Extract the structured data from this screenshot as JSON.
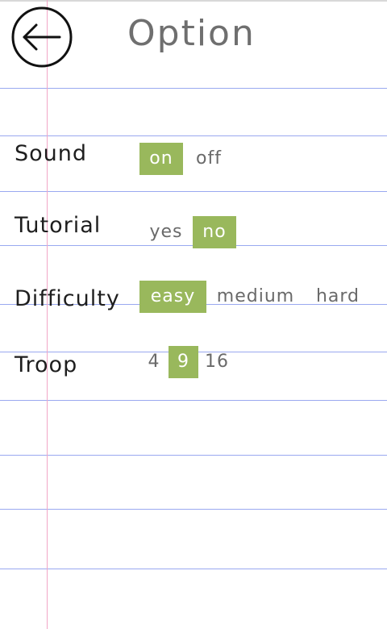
{
  "header": {
    "title": "Option",
    "back_icon": "arrow-left-circle-icon"
  },
  "settings": {
    "sound": {
      "label": "Sound",
      "options": [
        "on",
        "off"
      ],
      "selected": "on"
    },
    "tutorial": {
      "label": "Tutorial",
      "options": [
        "yes",
        "no"
      ],
      "selected": "no"
    },
    "difficulty": {
      "label": "Difficulty",
      "options": [
        "easy",
        "medium",
        "hard"
      ],
      "selected": "easy"
    },
    "troop": {
      "label": "Troop",
      "options": [
        "4",
        "9",
        "16"
      ],
      "selected": "9"
    }
  },
  "colors": {
    "selected_bg": "#99b85c",
    "rule_line": "#9aa9f0",
    "margin_line": "#f2a6c6"
  }
}
